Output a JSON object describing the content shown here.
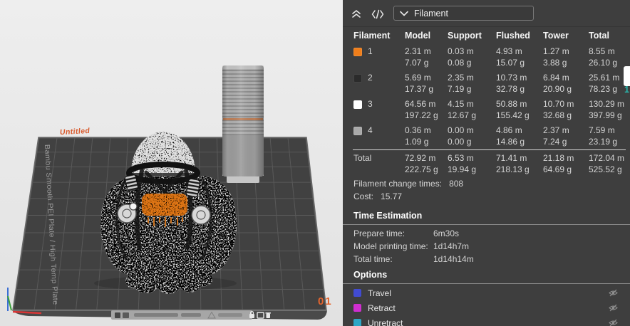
{
  "viewport": {
    "untitled_label": "Untitled",
    "plate_type_text": "Bambu Smooth PEI Plate / High Temp Plate",
    "plate_number": "01",
    "side_tab": "1",
    "colors": {
      "background": "#e9e9e9",
      "plate": "#414141",
      "grid_line": "#5a5a5a",
      "accent_orange": "#E2622B"
    }
  },
  "panel": {
    "colors": {
      "background": "#3E3E3E",
      "text": "#D4D4D4",
      "heading": "#FFFFFF",
      "divider": "#8D8D8D"
    },
    "header": {
      "dropdown_value": "Filament",
      "icons": [
        "collapse-up-icon",
        "gcode-icon",
        "chevron-down-icon"
      ]
    },
    "table": {
      "columns": [
        "Filament",
        "Model",
        "Support",
        "Flushed",
        "Tower",
        "Total"
      ],
      "rows": [
        {
          "id": "1",
          "color": "#F07E1A",
          "model": [
            "2.31 m",
            "7.07 g"
          ],
          "support": [
            "0.03 m",
            "0.08 g"
          ],
          "flushed": [
            "4.93 m",
            "15.07 g"
          ],
          "tower": [
            "1.27 m",
            "3.88 g"
          ],
          "total": [
            "8.55 m",
            "26.10 g"
          ]
        },
        {
          "id": "2",
          "color": "#2B2B2B",
          "model": [
            "5.69 m",
            "17.37 g"
          ],
          "support": [
            "2.35 m",
            "7.19 g"
          ],
          "flushed": [
            "10.73 m",
            "32.78 g"
          ],
          "tower": [
            "6.84 m",
            "20.90 g"
          ],
          "total": [
            "25.61 m",
            "78.23 g"
          ]
        },
        {
          "id": "3",
          "color": "#FFFFFF",
          "model": [
            "64.56 m",
            "197.22 g"
          ],
          "support": [
            "4.15 m",
            "12.67 g"
          ],
          "flushed": [
            "50.88 m",
            "155.42 g"
          ],
          "tower": [
            "10.70 m",
            "32.68 g"
          ],
          "total": [
            "130.29 m",
            "397.99 g"
          ]
        },
        {
          "id": "4",
          "color": "#A9A9A9",
          "model": [
            "0.36 m",
            "1.09 g"
          ],
          "support": [
            "0.00 m",
            "0.00 g"
          ],
          "flushed": [
            "4.86 m",
            "14.86 g"
          ],
          "tower": [
            "2.37 m",
            "7.24 g"
          ],
          "total": [
            "7.59 m",
            "23.19 g"
          ]
        }
      ],
      "total_row": {
        "label": "Total",
        "model": [
          "72.92 m",
          "222.75 g"
        ],
        "support": [
          "6.53 m",
          "19.94 g"
        ],
        "flushed": [
          "71.41 m",
          "218.13 g"
        ],
        "tower": [
          "21.18 m",
          "64.69 g"
        ],
        "total": [
          "172.04 m",
          "525.52 g"
        ]
      }
    },
    "stats": [
      {
        "label": "Filament change times:",
        "value": "808"
      },
      {
        "label": "Cost:",
        "value": "15.77"
      }
    ],
    "time_estimation": {
      "title": "Time Estimation",
      "rows": [
        {
          "label": "Prepare time:",
          "value": "6m30s"
        },
        {
          "label": "Model printing time:",
          "value": "1d14h7m"
        },
        {
          "label": "Total time:",
          "value": "1d14h14m"
        }
      ]
    },
    "options": {
      "title": "Options",
      "hide_icon": "eye-off-icon",
      "rows": [
        {
          "label": "Travel",
          "color": "#414BD1"
        },
        {
          "label": "Retract",
          "color": "#D02ED0"
        },
        {
          "label": "Unretract",
          "color": "#2EA7C6"
        }
      ]
    }
  }
}
